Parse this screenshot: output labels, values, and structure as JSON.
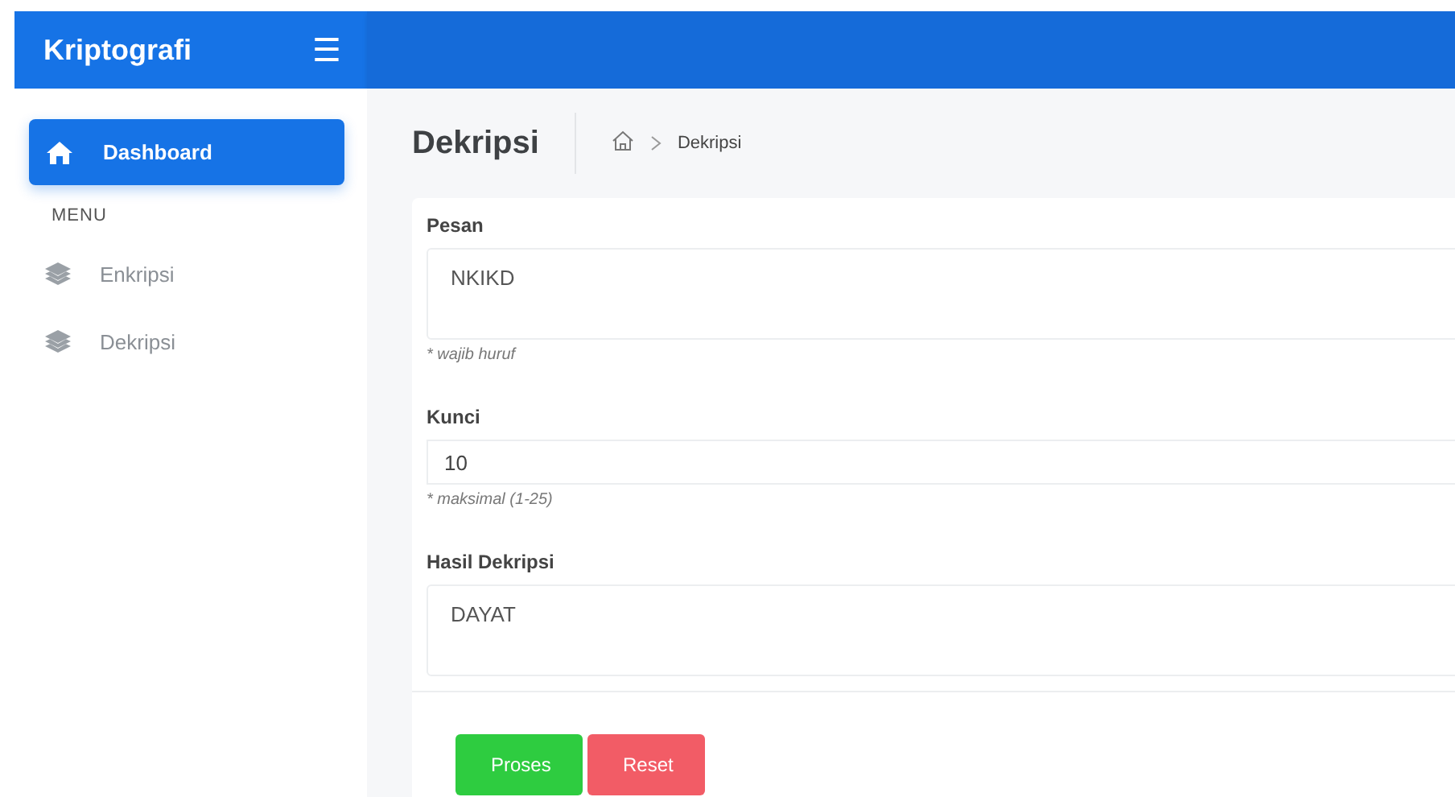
{
  "header": {
    "brand": "Kriptografi",
    "menu_glyph": "☰"
  },
  "sidebar": {
    "items": [
      {
        "label": "Dashboard",
        "kind": "home",
        "selected": true
      },
      {
        "label": "MENU",
        "kind": "heading"
      },
      {
        "label": "Enkripsi",
        "kind": "link",
        "selected": false
      },
      {
        "label": "Dekripsi",
        "kind": "link",
        "selected": false
      }
    ]
  },
  "page": {
    "title": "Dekripsi",
    "breadcrumb": [
      {
        "kind": "home"
      },
      {
        "label": "Dekripsi"
      }
    ]
  },
  "form": {
    "fields": [
      {
        "label": "Pesan",
        "kind": "textarea",
        "value": "NKIKD",
        "hint": "* wajib huruf"
      },
      {
        "label": "Kunci",
        "kind": "input",
        "value": "10",
        "hint": "* maksimal (1-25)"
      },
      {
        "label": "Hasil Dekripsi",
        "kind": "textarea",
        "value": "DAYAT"
      }
    ],
    "buttons": [
      {
        "label": "Proses",
        "kind": "primary"
      },
      {
        "label": "Reset",
        "kind": "danger"
      }
    ]
  }
}
